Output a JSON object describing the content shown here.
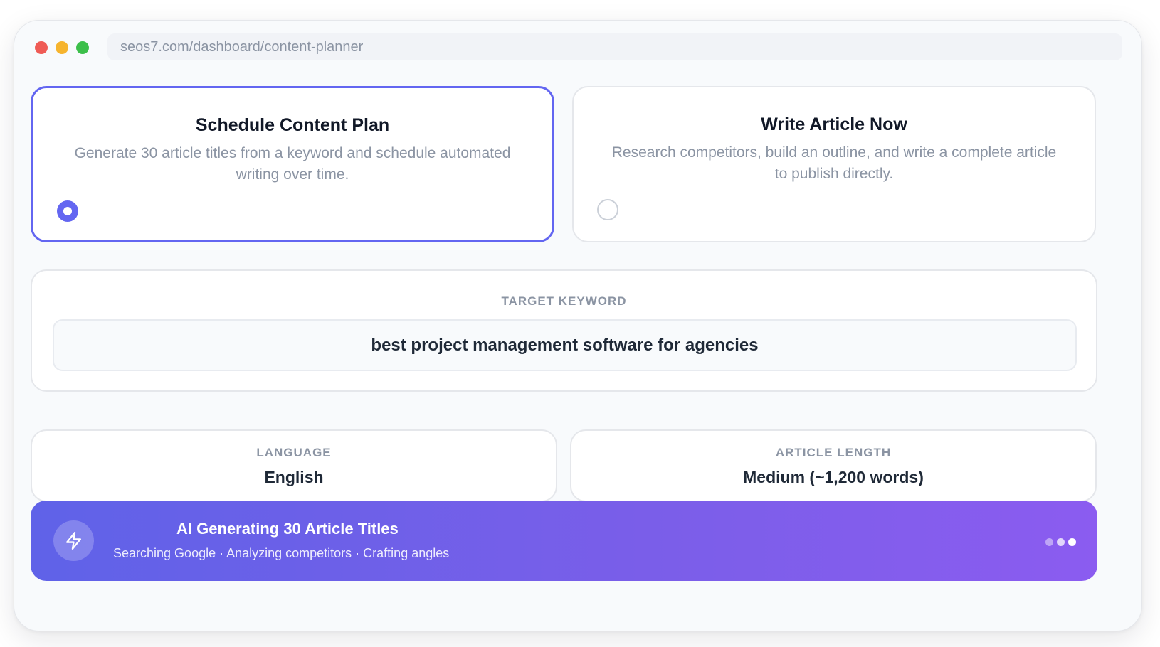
{
  "browser": {
    "url": "seos7.com/dashboard/content-planner"
  },
  "modes": [
    {
      "title": "Schedule Content Plan",
      "description": "Generate 30 article titles from a keyword and schedule automated writing over time.",
      "selected": true
    },
    {
      "title": "Write Article Now",
      "description": "Research competitors, build an outline, and write a complete article to publish directly.",
      "selected": false
    }
  ],
  "keyword": {
    "label": "TARGET KEYWORD",
    "value": "best project management software for agencies"
  },
  "language": {
    "label": "LANGUAGE",
    "value": "English"
  },
  "article_length": {
    "label": "ARTICLE LENGTH",
    "value": "Medium (~1,200 words)"
  },
  "status_banner": {
    "title": "AI Generating 30 Article Titles",
    "subtitle": "Searching Google · Analyzing competitors · Crafting angles",
    "icon": "lightning-bolt-icon"
  },
  "colors": {
    "accent": "#6366f1",
    "banner_start": "#5f62e8",
    "banner_end": "#8b5cf0"
  }
}
